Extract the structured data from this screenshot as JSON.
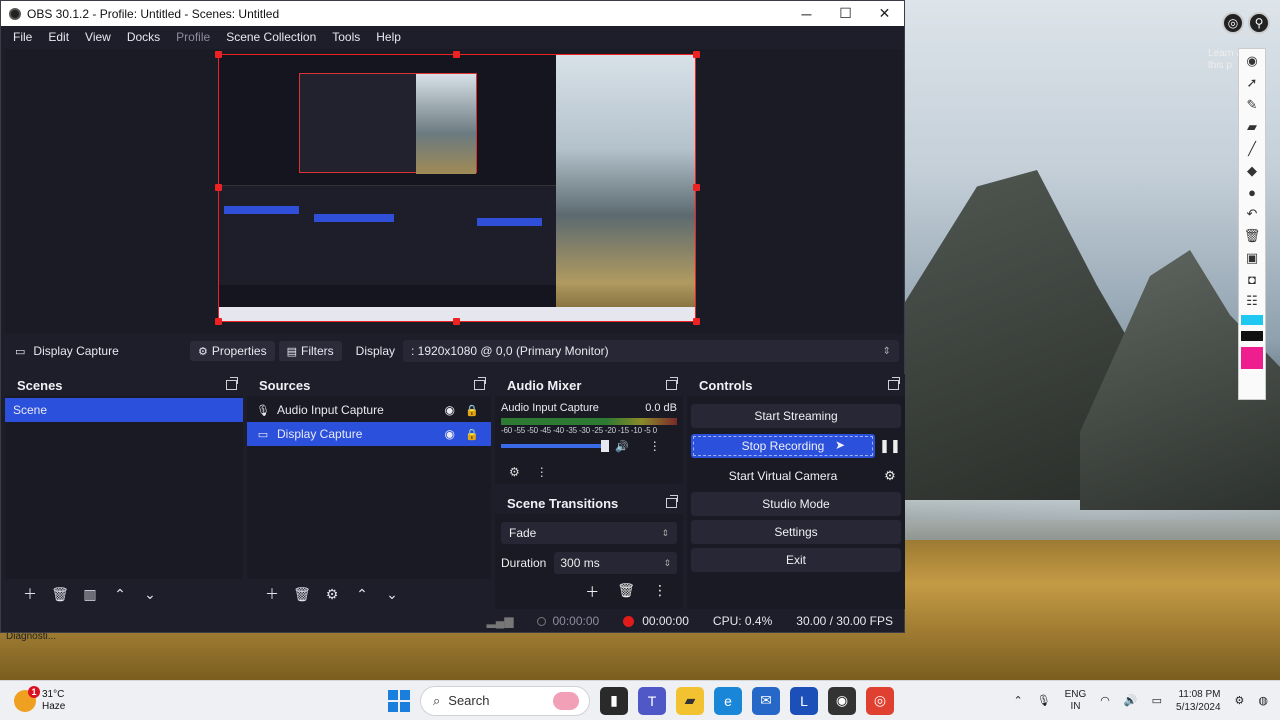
{
  "window": {
    "title": "OBS 30.1.2 - Profile: Untitled - Scenes: Untitled"
  },
  "menu": [
    "File",
    "Edit",
    "View",
    "Docks",
    "Profile",
    "Scene Collection",
    "Tools",
    "Help"
  ],
  "source_toolbar": {
    "source_name": "Display Capture",
    "properties_label": "Properties",
    "filters_label": "Filters",
    "display_label": "Display",
    "display_value": ": 1920x1080 @ 0,0 (Primary Monitor)"
  },
  "scenes": {
    "title": "Scenes",
    "items": [
      "Scene"
    ]
  },
  "sources": {
    "title": "Sources",
    "items": [
      "Audio Input Capture",
      "Display Capture"
    ]
  },
  "mixer": {
    "title": "Audio Mixer",
    "channel_name": "Audio Input Capture",
    "channel_db": "0.0 dB",
    "scale": "-60 -55 -50 -45 -40 -35 -30 -25 -20 -15 -10 -5 0"
  },
  "transitions": {
    "title": "Scene Transitions",
    "type": "Fade",
    "duration_label": "Duration",
    "duration_value": "300 ms"
  },
  "controls": {
    "title": "Controls",
    "start_streaming": "Start Streaming",
    "stop_recording": "Stop Recording",
    "start_virtual_camera": "Start Virtual Camera",
    "studio_mode": "Studio Mode",
    "settings": "Settings",
    "exit": "Exit"
  },
  "status": {
    "stream_time": "00:00:00",
    "rec_time": "00:00:00",
    "cpu": "CPU: 0.4%",
    "fps": "30.00 / 30.00 FPS"
  },
  "desktop": {
    "learn_text_1": "Learn a",
    "learn_text_2": "this p",
    "diagnostics": "Diagnosti..."
  },
  "taskbar": {
    "weather_temp": "31°C",
    "weather_desc": "Haze",
    "weather_badge": "1",
    "search_placeholder": "Search",
    "lang_1": "ENG",
    "lang_2": "IN",
    "time": "11:08 PM",
    "date": "5/13/2024"
  },
  "colors": {
    "accent": "#2a50dc",
    "record": "#e01b1b",
    "panel": "#1e1e2a"
  }
}
